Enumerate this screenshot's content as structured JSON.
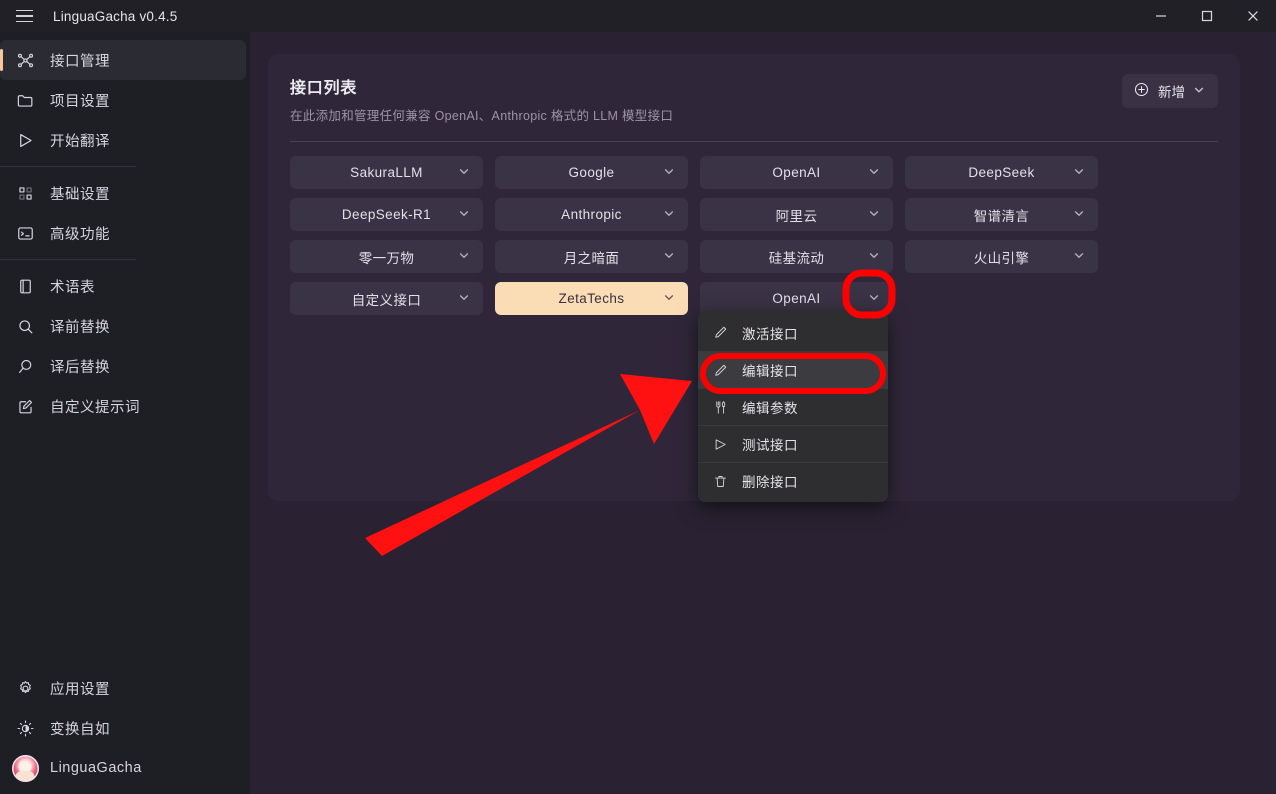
{
  "window": {
    "title": "LinguaGacha v0.4.5",
    "menu_icon": "hamburger-icon",
    "controls": {
      "minimize": "minimize-icon",
      "maximize": "maximize-icon",
      "close": "close-icon"
    }
  },
  "sidebar": {
    "items": [
      {
        "label": "接口管理",
        "icon": "network-nodes-icon",
        "active": true
      },
      {
        "label": "项目设置",
        "icon": "folder-icon",
        "active": false
      },
      {
        "label": "开始翻译",
        "icon": "play-icon",
        "active": false
      },
      {
        "label": "基础设置",
        "icon": "sliders-box-icon",
        "active": false
      },
      {
        "label": "高级功能",
        "icon": "terminal-icon",
        "active": false
      },
      {
        "label": "术语表",
        "icon": "book-icon",
        "active": false
      },
      {
        "label": "译前替换",
        "icon": "search-icon",
        "active": false
      },
      {
        "label": "译后替换",
        "icon": "search-alt-icon",
        "active": false
      },
      {
        "label": "自定义提示词",
        "icon": "edit-square-icon",
        "active": false
      }
    ],
    "bottom_items": [
      {
        "label": "应用设置",
        "icon": "gear-icon"
      },
      {
        "label": "变换自如",
        "icon": "theme-contrast-icon"
      },
      {
        "label": "LinguaGacha",
        "icon": "avatar"
      }
    ]
  },
  "main": {
    "card_title": "接口列表",
    "card_subtitle": "在此添加和管理任何兼容 OpenAI、Anthropic 格式的 LLM 模型接口",
    "add_button": {
      "label": "新增",
      "icon": "plus-circle-icon",
      "chevron": "chevron-down-icon"
    },
    "interfaces": [
      {
        "label": "SakuraLLM",
        "active": false
      },
      {
        "label": "Google",
        "active": false
      },
      {
        "label": "OpenAI",
        "active": false
      },
      {
        "label": "DeepSeek",
        "active": false
      },
      {
        "label": "DeepSeek-R1",
        "active": false
      },
      {
        "label": "Anthropic",
        "active": false
      },
      {
        "label": "阿里云",
        "active": false
      },
      {
        "label": "智谱清言",
        "active": false
      },
      {
        "label": "零一万物",
        "active": false
      },
      {
        "label": "月之暗面",
        "active": false
      },
      {
        "label": "硅基流动",
        "active": false
      },
      {
        "label": "火山引擎",
        "active": false
      },
      {
        "label": "自定义接口",
        "active": false
      },
      {
        "label": "ZetaTechs",
        "active": true
      },
      {
        "label": "OpenAI",
        "active": false
      }
    ]
  },
  "context_menu": {
    "items": [
      {
        "label": "激活接口",
        "icon": "pencil-icon",
        "highlighted": false
      },
      {
        "label": "编辑接口",
        "icon": "pencil-icon",
        "highlighted": true
      },
      {
        "label": "编辑参数",
        "icon": "utensils-icon",
        "highlighted": false
      },
      {
        "label": "测试接口",
        "icon": "play-icon",
        "highlighted": false
      },
      {
        "label": "删除接口",
        "icon": "trash-icon",
        "highlighted": false
      }
    ]
  },
  "annotations": {
    "arrow_color": "#ff1111",
    "highlight_color": "#ff0000",
    "targets": [
      "chevron-rounded-rect",
      "edit-interface-oval",
      "arrow-pointing-to-menu"
    ]
  },
  "colors": {
    "window_chrome": "#202026",
    "sidebar_bg": "#1e1e25",
    "content_bg": "#2a2233",
    "card_bg": "#2f2739",
    "button_bg": "#3a3245",
    "accent": "#fadcb5",
    "menu_bg": "#2e2e31"
  }
}
